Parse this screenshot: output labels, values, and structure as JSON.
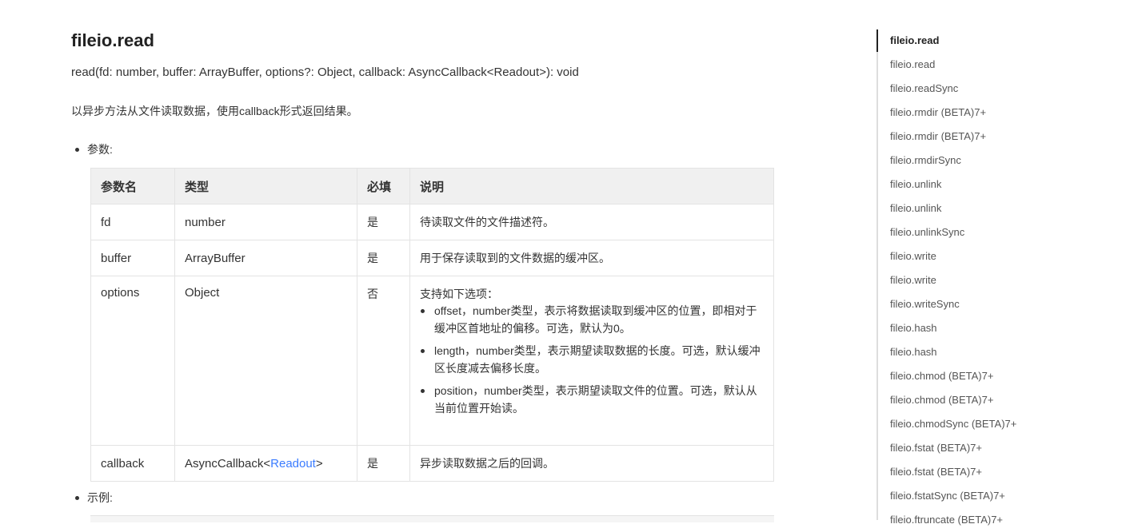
{
  "heading": "fileio.read",
  "signature": "read(fd: number, buffer: ArrayBuffer, options?: Object, callback: AsyncCallback<Readout>): void",
  "description": "以异步方法从文件读取数据，使用callback形式返回结果。",
  "params_label": "参数:",
  "example_label": "示例:",
  "table": {
    "headers": [
      "参数名",
      "类型",
      "必填",
      "说明"
    ],
    "rows": [
      {
        "name": "fd",
        "type": "number",
        "required": "是",
        "desc": "待读取文件的文件描述符。"
      },
      {
        "name": "buffer",
        "type": "ArrayBuffer",
        "required": "是",
        "desc": "用于保存读取到的文件数据的缓冲区。"
      },
      {
        "name": "options",
        "type": "Object",
        "required": "否",
        "desc_intro": "支持如下选项：",
        "desc_items": [
          "offset，number类型，表示将数据读取到缓冲区的位置，即相对于缓冲区首地址的偏移。可选，默认为0。",
          "length，number类型，表示期望读取数据的长度。可选，默认缓冲区长度减去偏移长度。",
          "position，number类型，表示期望读取文件的位置。可选，默认从当前位置开始读。"
        ]
      },
      {
        "name": "callback",
        "type_prefix": "AsyncCallback<",
        "type_link": "Readout",
        "type_suffix": ">",
        "required": "是",
        "desc": "异步读取数据之后的回调。"
      }
    ]
  },
  "toc": {
    "items": [
      "fileio.read",
      "fileio.read",
      "fileio.readSync",
      "fileio.rmdir (BETA)7+",
      "fileio.rmdir (BETA)7+",
      "fileio.rmdirSync",
      "fileio.unlink",
      "fileio.unlink",
      "fileio.unlinkSync",
      "fileio.write",
      "fileio.write",
      "fileio.writeSync",
      "fileio.hash",
      "fileio.hash",
      "fileio.chmod (BETA)7+",
      "fileio.chmod (BETA)7+",
      "fileio.chmodSync (BETA)7+",
      "fileio.fstat (BETA)7+",
      "fileio.fstat (BETA)7+",
      "fileio.fstatSync (BETA)7+",
      "fileio.ftruncate (BETA)7+"
    ],
    "active_index": 0
  },
  "colors": {
    "link": "#3b7cff",
    "text": "#333333",
    "header_bg": "#f0f0f0"
  }
}
